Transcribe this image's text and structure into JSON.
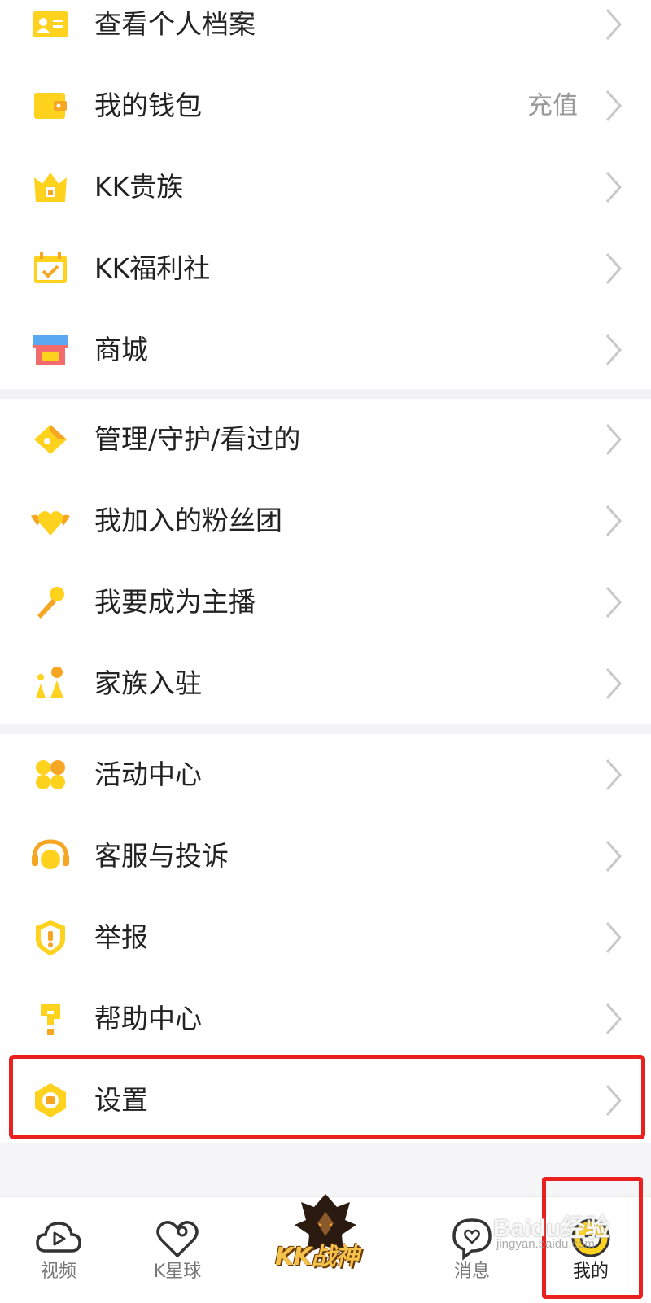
{
  "menu_group_1": [
    {
      "label": "查看个人档案",
      "icon": "profile-card-icon"
    },
    {
      "label": "我的钱包",
      "icon": "wallet-icon",
      "right_text": "充值"
    },
    {
      "label": "KK贵族",
      "icon": "crown-icon"
    },
    {
      "label": "KK福利社",
      "icon": "calendar-check-icon"
    },
    {
      "label": "商城",
      "icon": "store-icon"
    }
  ],
  "menu_group_2": [
    {
      "label": "管理/守护/看过的",
      "icon": "diamond-icon"
    },
    {
      "label": "我加入的粉丝团",
      "icon": "winged-heart-icon"
    },
    {
      "label": "我要成为主播",
      "icon": "microphone-icon"
    },
    {
      "label": "家族入驻",
      "icon": "family-icon"
    }
  ],
  "menu_group_3": [
    {
      "label": "活动中心",
      "icon": "clover-icon"
    },
    {
      "label": "客服与投诉",
      "icon": "headset-icon"
    },
    {
      "label": "举报",
      "icon": "report-shield-icon"
    },
    {
      "label": "帮助中心",
      "icon": "question-icon"
    },
    {
      "label": "设置",
      "icon": "settings-hexagon-icon"
    }
  ],
  "tabbar": {
    "items": [
      {
        "label": "视频",
        "icon": "video-cloud-icon"
      },
      {
        "label": "K星球",
        "icon": "heart-planet-icon"
      },
      {
        "label": "KK战神",
        "icon": "kk-zhanshen-logo"
      },
      {
        "label": "消息",
        "icon": "message-heart-icon"
      },
      {
        "label": "我的",
        "icon": "smiley-avatar-icon"
      }
    ],
    "active": "我的"
  },
  "watermark": {
    "text": "Baidu经验",
    "sub": "jingyan.baidu.com"
  },
  "colors": {
    "accent": "#FFD21E",
    "highlight": "#E9201E",
    "chevron": "#C8C8C8"
  }
}
